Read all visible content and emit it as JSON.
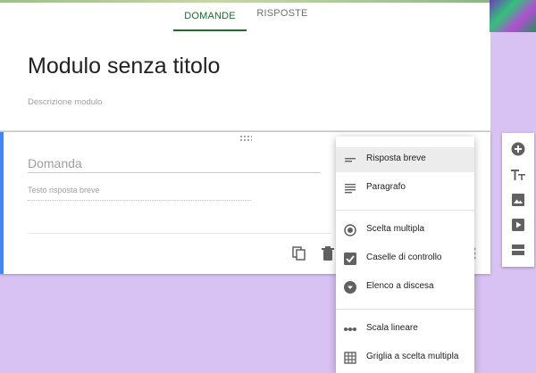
{
  "tabs": [
    {
      "label": "DOMANDE",
      "active": true
    },
    {
      "label": "RISPOSTE",
      "active": false
    }
  ],
  "colors": {
    "accent": "#1e6b2e",
    "background": "#d7c2f3",
    "card_border": "#4285f4"
  },
  "form": {
    "title": "Modulo senza titolo",
    "description_placeholder": "Descrizione modulo"
  },
  "question": {
    "title_placeholder": "Domanda",
    "answer_placeholder": "Testo risposta breve"
  },
  "question_type_menu": {
    "items": [
      {
        "label": "Risposta breve",
        "icon": "short-text-icon",
        "selected": true
      },
      {
        "label": "Paragrafo",
        "icon": "paragraph-icon",
        "selected": false
      },
      {
        "label": "Scelta multipla",
        "icon": "radio-button-icon",
        "selected": false
      },
      {
        "label": "Caselle di controllo",
        "icon": "checkbox-icon",
        "selected": false
      },
      {
        "label": "Elenco a discesa",
        "icon": "dropdown-arrow-icon",
        "selected": false
      },
      {
        "label": "Scala lineare",
        "icon": "linear-scale-icon",
        "selected": false
      },
      {
        "label": "Griglia a scelta multipla",
        "icon": "grid-icon",
        "selected": false
      }
    ]
  },
  "card_actions": [
    "copy-icon",
    "trash-icon",
    "more-vert-icon"
  ],
  "side_toolbar": [
    "add-question-icon",
    "add-title-icon",
    "add-image-icon",
    "add-video-icon",
    "add-section-icon"
  ]
}
